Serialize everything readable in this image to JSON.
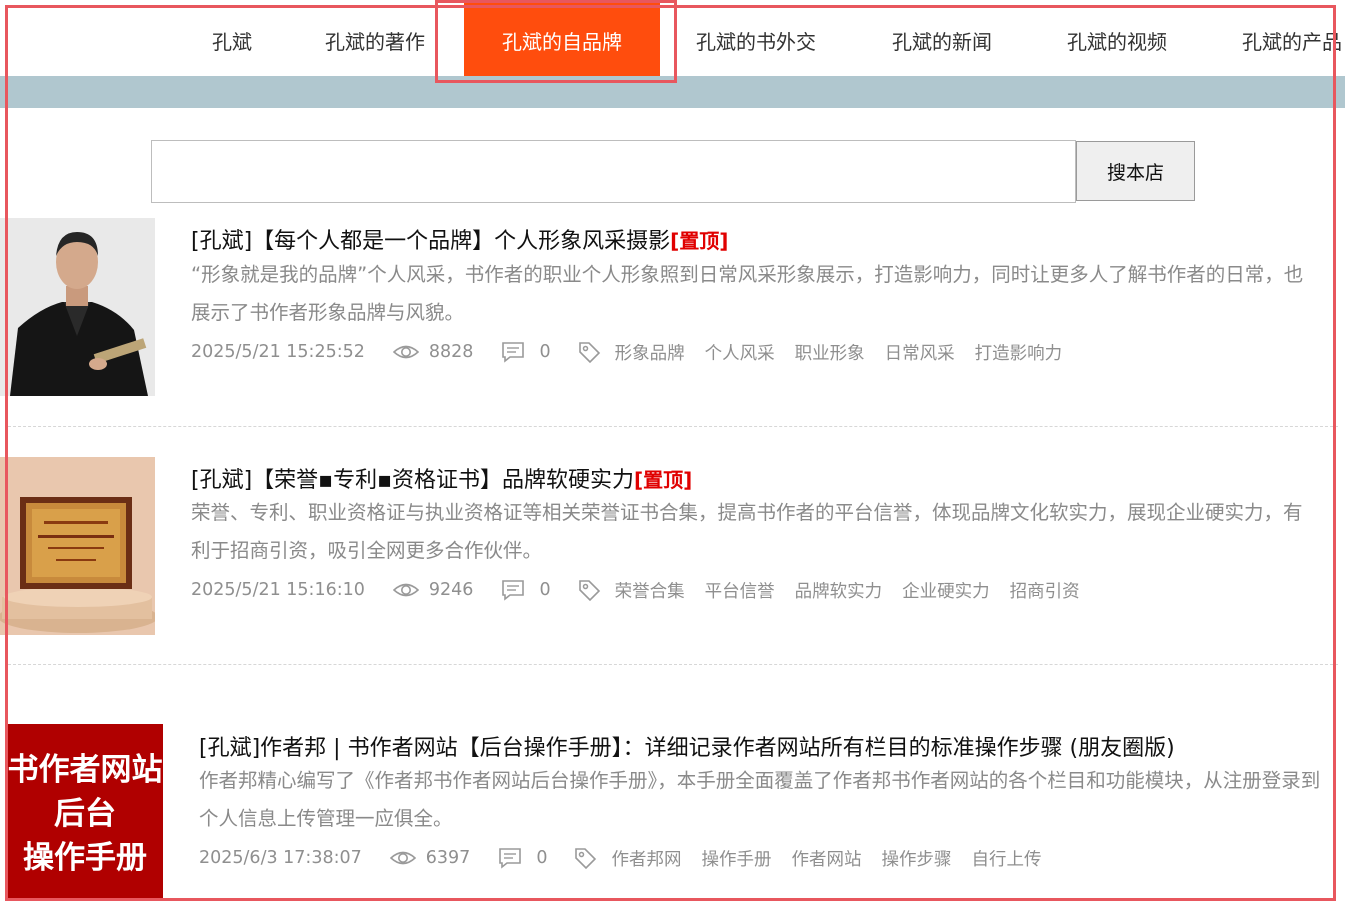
{
  "nav": {
    "items": [
      {
        "label": "孔斌"
      },
      {
        "label": "孔斌的著作"
      },
      {
        "label": "孔斌的自品牌",
        "active": true
      },
      {
        "label": "孔斌的书外交"
      },
      {
        "label": "孔斌的新闻"
      },
      {
        "label": "孔斌的视频"
      },
      {
        "label": "孔斌的产品"
      }
    ],
    "active_color": "#ff4d0d",
    "band_color": "#b0c7cf"
  },
  "search": {
    "value": "",
    "placeholder": "",
    "button_label": "搜本店"
  },
  "articles": [
    {
      "title": "[孔斌]【每个人都是一个品牌】个人形象风采摄影",
      "pin": "[置顶]",
      "desc": "“形象就是我的品牌”个人风采，书作者的职业个人形象照到日常风采形象展示，打造影响力，同时让更多人了解书作者的日常，也展示了书作者形象品牌与风貌。",
      "date": "2025/5/21 15:25:52",
      "views": "8828",
      "comments": "0",
      "tags": [
        "形象品牌",
        "个人风采",
        "职业形象",
        "日常风采",
        "打造影响力"
      ],
      "thumb_icon": "portrait-photo"
    },
    {
      "title": "[孔斌]【荣誉▪专利▪资格证书】品牌软硬实力",
      "pin": "[置顶]",
      "desc": "荣誉、专利、职业资格证与执业资格证等相关荣誉证书合集，提高书作者的平台信誉，体现品牌文化软实力，展现企业硬实力，有利于招商引资，吸引全网更多合作伙伴。",
      "date": "2025/5/21 15:16:10",
      "views": "9246",
      "comments": "0",
      "tags": [
        "荣誉合集",
        "平台信誉",
        "品牌软实力",
        "企业硬实力",
        "招商引资"
      ],
      "thumb_icon": "certificate-photo"
    },
    {
      "title": "[孔斌]作者邦 | 书作者网站【后台操作手册】：详细记录作者网站所有栏目的标准操作步骤 (朋友圈版)",
      "desc": "作者邦精心编写了《作者邦书作者网站后台操作手册》，本手册全面覆盖了作者邦书作者网站的各个栏目和功能模块，从注册登录到个人信息上传管理一应俱全。",
      "date": "2025/6/3 17:38:07",
      "views": "6397",
      "comments": "0",
      "tags": [
        "作者邦网",
        "操作手册",
        "作者网站",
        "操作步骤",
        "自行上传"
      ],
      "thumb_lines": [
        "书作者网站",
        "后台",
        "操作手册"
      ],
      "thumb_color": "#b00000"
    }
  ]
}
